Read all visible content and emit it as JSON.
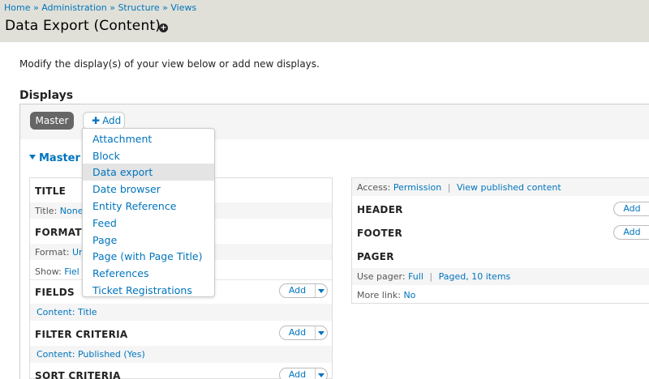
{
  "breadcrumb": {
    "items": [
      "Home",
      "Administration",
      "Structure",
      "Views"
    ],
    "sep": "»"
  },
  "page": {
    "title": "Data Export (Content)",
    "shortcut_glyph": "+"
  },
  "intro": "Modify the display(s) of your view below or add new displays.",
  "displays": {
    "heading": "Displays",
    "master_tab": "Master",
    "add_tab": "Add",
    "add_glyph": "✚"
  },
  "section": {
    "heading": "Master"
  },
  "left": {
    "title": {
      "heading": "TITLE",
      "label": "Title:",
      "value": "None"
    },
    "format": {
      "heading": "FORMAT",
      "format_label": "Format:",
      "format_value": "Un",
      "show_label": "Show:",
      "show_value": "Fiel"
    },
    "fields": {
      "heading": "FIELDS",
      "add": "Add",
      "item": "Content: Title"
    },
    "filter": {
      "heading": "FILTER CRITERIA",
      "add": "Add",
      "item": "Content: Published (Yes)"
    },
    "sort": {
      "heading": "SORT CRITERIA",
      "add": "Add"
    }
  },
  "right": {
    "access": {
      "label": "Access:",
      "value": "Permission",
      "sep": "|",
      "value2": "View published content"
    },
    "header": {
      "heading": "HEADER",
      "add": "Add"
    },
    "footer": {
      "heading": "FOOTER",
      "add": "Add"
    },
    "pager": {
      "heading": "PAGER",
      "use_label": "Use pager:",
      "use_value": "Full",
      "sep": "|",
      "use_value2": "Paged, 10 items",
      "more_label": "More link:",
      "more_value": "No"
    }
  },
  "dropdown": {
    "items": [
      "Attachment",
      "Block",
      "Data export",
      "Date browser",
      "Entity Reference",
      "Feed",
      "Page",
      "Page (with Page Title)",
      "References",
      "Ticket Registrations"
    ],
    "active_index": 2
  }
}
